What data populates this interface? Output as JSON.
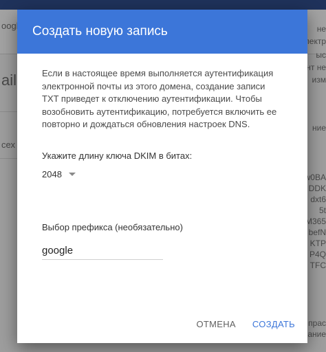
{
  "background": {
    "left": [
      "oogle",
      "ail",
      "сех"
    ],
    "right": [
      "не",
      "электр",
      "ыс",
      "нт не",
      "изм",
      "ние",
      "w0BA",
      "DDK",
      "dxt6",
      "5t",
      "M365",
      "befN",
      "KTP",
      "P4Q",
      "TFC",
      "прас",
      "ание"
    ]
  },
  "dialog": {
    "title": "Создать новую запись",
    "description": "Если в настоящее время выполняется аутентификация электронной почты из этого домена, создание записи TXT приведет к отключению аутентификации. Чтобы возобновить аутентификацию, потребуется включить ее повторно и дождаться обновления настроек DNS.",
    "key_length_label": "Укажите длину ключа DKIM в битах:",
    "key_length_value": "2048",
    "prefix_label": "Выбор префикса (необязательно)",
    "prefix_value": "google",
    "cancel_label": "ОТМЕНА",
    "create_label": "СОЗДАТЬ"
  },
  "colors": {
    "header": "#3c76d9",
    "primary_button": "#3c76d9"
  }
}
